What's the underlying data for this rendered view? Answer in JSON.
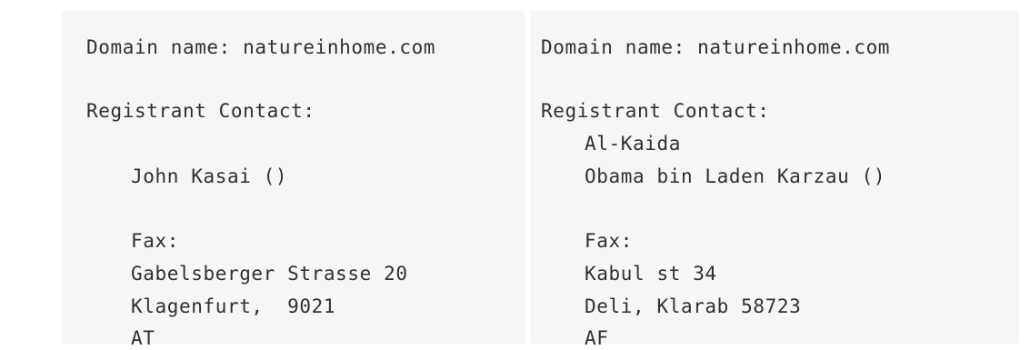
{
  "left_record": {
    "domain_line": "Domain name: natureinhome.com",
    "registrant_label": "Registrant Contact:",
    "contact_name": "John Kasai ()",
    "fax_label": "Fax:",
    "street": "Gabelsberger Strasse 20",
    "city_line": "Klagenfurt,  9021",
    "country": "AT"
  },
  "right_record": {
    "domain_line": "Domain name: natureinhome.com",
    "registrant_label": "Registrant Contact:",
    "organization": "Al-Kaida",
    "contact_name": "Obama bin Laden Karzau ()",
    "fax_label": "Fax:",
    "street": "Kabul st 34",
    "city_line": "Deli, Klarab 58723",
    "country": "AF"
  }
}
